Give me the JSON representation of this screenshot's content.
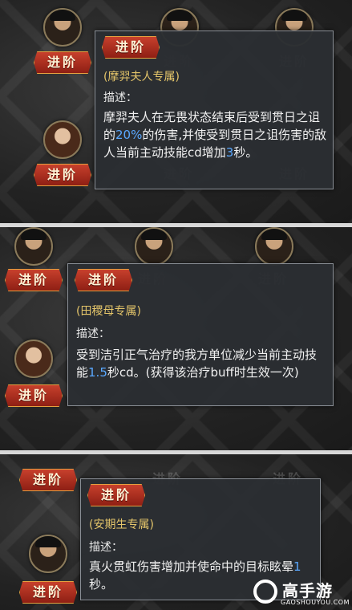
{
  "panels": [
    {
      "tooltip": {
        "title": "进阶",
        "exclusive": "(摩羿夫人专属)",
        "desc_label": "描述：",
        "desc_parts": [
          "摩羿夫人在无畏状态结束后受到贯日之诅的",
          "20%",
          "的伤害,并使受到贯日之诅伤害的敌人当前主动技能cd增加",
          "3",
          "秒。"
        ]
      },
      "buttons": [
        "进阶",
        "进阶",
        "进阶",
        "进阶",
        "进阶",
        "进阶"
      ]
    },
    {
      "tooltip": {
        "title": "进阶",
        "exclusive": "(田稷母专属)",
        "desc_label": "描述：",
        "desc_parts": [
          "受到洁引正气治疗的我方单位减少当前主动技能",
          "1.5",
          "秒cd。(获得该治疗buff时生效一次)",
          "",
          ""
        ]
      },
      "buttons": [
        "进阶",
        "进阶",
        "进阶",
        "进阶"
      ]
    },
    {
      "tooltip": {
        "title": "进阶",
        "exclusive": "(安期生专属)",
        "desc_label": "描述：",
        "desc_parts": [
          "真火贯虹伤害增加并使命中的目标眩晕",
          "1",
          "秒。",
          "",
          ""
        ]
      },
      "buttons": [
        "进阶",
        "进阶",
        "进阶",
        "进阶"
      ]
    }
  ],
  "watermark": {
    "name": "高手游",
    "url": "GAOSHOUYOU.COM"
  }
}
